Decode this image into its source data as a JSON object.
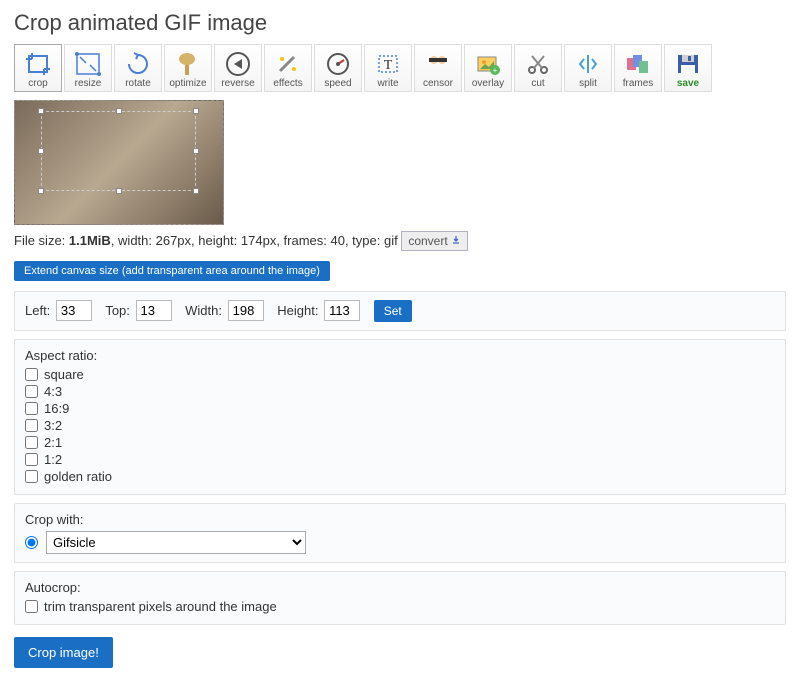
{
  "title": "Crop animated GIF image",
  "toolbar": [
    {
      "label": "crop",
      "active": true
    },
    {
      "label": "resize"
    },
    {
      "label": "rotate"
    },
    {
      "label": "optimize"
    },
    {
      "label": "reverse"
    },
    {
      "label": "effects"
    },
    {
      "label": "speed"
    },
    {
      "label": "write"
    },
    {
      "label": "censor"
    },
    {
      "label": "overlay"
    },
    {
      "label": "cut"
    },
    {
      "label": "split"
    },
    {
      "label": "frames"
    },
    {
      "label": "save"
    }
  ],
  "fileinfo": {
    "prefix": "File size: ",
    "size": "1.1MiB",
    "rest": ", width: 267px, height: 174px, frames: 40, type: gif",
    "convert": "convert"
  },
  "extend": "Extend canvas size (add transparent area around the image)",
  "dims": {
    "left_lbl": "Left:",
    "left": "33",
    "top_lbl": "Top:",
    "top": "13",
    "width_lbl": "Width:",
    "width": "198",
    "height_lbl": "Height:",
    "height": "113",
    "set": "Set"
  },
  "aspect": {
    "label": "Aspect ratio:",
    "options": [
      "square",
      "4:3",
      "16:9",
      "3:2",
      "2:1",
      "1:2",
      "golden ratio"
    ]
  },
  "cropwith": {
    "label": "Crop with:",
    "selected": "Gifsicle"
  },
  "autocrop": {
    "label": "Autocrop:",
    "option": "trim transparent pixels around the image"
  },
  "crop_btn": "Crop image!"
}
